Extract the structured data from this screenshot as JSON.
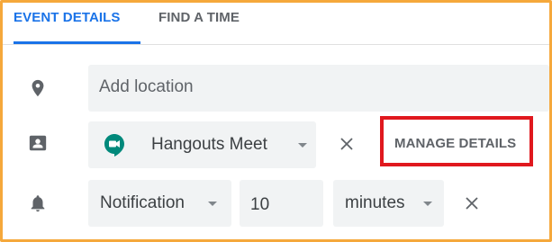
{
  "tabs": [
    {
      "label": "EVENT DETAILS",
      "active": true
    },
    {
      "label": "FIND A TIME",
      "active": false
    }
  ],
  "location": {
    "placeholder": "Add location",
    "icon": "location-pin-icon"
  },
  "conferencing": {
    "icon": "video-conference-card-icon",
    "provider_label": "Hangouts Meet",
    "provider_logo": "hangouts-meet-logo",
    "manage_label": "MANAGE DETAILS",
    "highlight_color": "#e0181e"
  },
  "notification": {
    "icon": "bell-icon",
    "type_label": "Notification",
    "value": "10",
    "unit_label": "minutes"
  },
  "colors": {
    "accent": "#1a73e8",
    "frame_border": "#f5a83b",
    "field_bg": "#f1f3f4",
    "hangouts_green": "#00897b"
  }
}
